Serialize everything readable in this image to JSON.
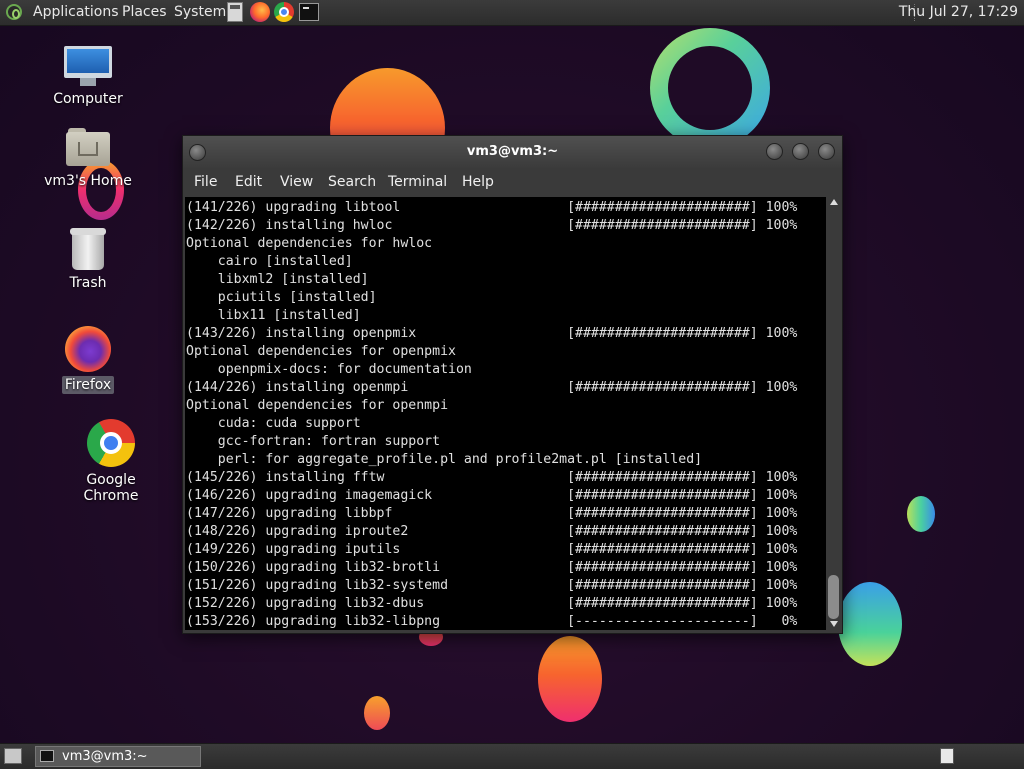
{
  "top_panel": {
    "menus": [
      "Applications",
      "Places",
      "System"
    ],
    "launchers": [
      "calculator-icon",
      "firefox-icon",
      "chrome-icon",
      "terminal-icon"
    ],
    "clock": "Thu Jul 27, 17:29"
  },
  "desktop_icons": {
    "computer": "Computer",
    "home": "vm3's Home",
    "trash": "Trash",
    "firefox": "Firefox",
    "chrome": "Google Chrome"
  },
  "terminal": {
    "title": "vm3@vm3:~",
    "menu": [
      "File",
      "Edit",
      "View",
      "Search",
      "Terminal",
      "Help"
    ],
    "lines": [
      "(141/226) upgrading libtool                     [######################] 100%",
      "(142/226) installing hwloc                      [######################] 100%",
      "Optional dependencies for hwloc",
      "    cairo [installed]",
      "    libxml2 [installed]",
      "    pciutils [installed]",
      "    libx11 [installed]",
      "(143/226) installing openpmix                   [######################] 100%",
      "Optional dependencies for openpmix",
      "    openpmix-docs: for documentation",
      "(144/226) installing openmpi                    [######################] 100%",
      "Optional dependencies for openmpi",
      "    cuda: cuda support",
      "    gcc-fortran: fortran support",
      "    perl: for aggregate_profile.pl and profile2mat.pl [installed]",
      "(145/226) installing fftw                       [######################] 100%",
      "(146/226) upgrading imagemagick                 [######################] 100%",
      "(147/226) upgrading libbpf                      [######################] 100%",
      "(148/226) upgrading iproute2                    [######################] 100%",
      "(149/226) upgrading iputils                     [######################] 100%",
      "(150/226) upgrading lib32-brotli                [######################] 100%",
      "(151/226) upgrading lib32-systemd               [######################] 100%",
      "(152/226) upgrading lib32-dbus                  [######################] 100%",
      "(153/226) upgrading lib32-libpng                [----------------------]   0%"
    ]
  },
  "taskbar": {
    "task_label": "vm3@vm3:~"
  }
}
